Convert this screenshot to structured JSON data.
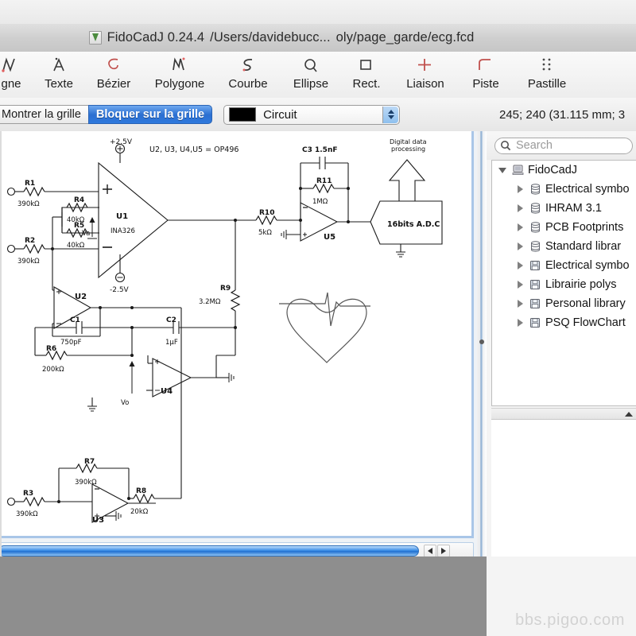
{
  "window": {
    "title_app": "FidoCadJ 0.24.4",
    "title_path": "/Users/davidebucc...",
    "title_file": "oly/page_garde/ecg.fcd",
    "app_icon": "fidocadj-leaf-icon"
  },
  "toolbar": {
    "tools": [
      {
        "label": "gne",
        "icon": "polyline-icon"
      },
      {
        "label": "Texte",
        "icon": "text-A-icon"
      },
      {
        "label": "Bézier",
        "icon": "bezier-curve-icon"
      },
      {
        "label": "Polygone",
        "icon": "polygon-icon"
      },
      {
        "label": "Courbe",
        "icon": "curve-icon"
      },
      {
        "label": "Ellipse",
        "icon": "ellipse-icon"
      },
      {
        "label": "Rect.",
        "icon": "rectangle-icon"
      },
      {
        "label": "Liaison",
        "icon": "connection-plus-icon"
      },
      {
        "label": "Piste",
        "icon": "track-icon"
      },
      {
        "label": "Pastille",
        "icon": "pad-dots-icon"
      }
    ]
  },
  "grid_toolbar": {
    "show_grid_label": "Montrer la grille",
    "snap_grid_label": "Bloquer sur la grille",
    "snap_active": true,
    "layer_color": "#000000",
    "layer_name": "Circuit"
  },
  "status": {
    "coordinates": "245; 240 (31.115 mm; 3"
  },
  "library_panel": {
    "search_placeholder": "Search",
    "search_value": "",
    "search_icon": "magnifier-icon",
    "tree": [
      {
        "label": "FidoCadJ",
        "icon": "computer-icon",
        "level": 1,
        "expanded": true
      },
      {
        "label": "Electrical symbo",
        "icon": "database-icon",
        "level": 2,
        "expanded": false
      },
      {
        "label": "IHRAM 3.1",
        "icon": "database-icon",
        "level": 2,
        "expanded": false
      },
      {
        "label": "PCB Footprints",
        "icon": "database-icon",
        "level": 2,
        "expanded": false
      },
      {
        "label": "Standard librar",
        "icon": "database-icon",
        "level": 2,
        "expanded": false
      },
      {
        "label": "Electrical symbo",
        "icon": "floppy-icon",
        "level": 2,
        "expanded": false
      },
      {
        "label": "Librairie polys",
        "icon": "floppy-icon",
        "level": 2,
        "expanded": false
      },
      {
        "label": "Personal library",
        "icon": "floppy-icon",
        "level": 2,
        "expanded": false
      },
      {
        "label": "PSQ FlowChart",
        "icon": "floppy-icon",
        "level": 2,
        "expanded": false
      }
    ]
  },
  "schematic": {
    "note_opamps": "U2, U3, U4,U5 = OP496",
    "labels": {
      "r1": "R1",
      "r1v": "390kΩ",
      "r2": "R2",
      "r2v": "390kΩ",
      "r3": "R3",
      "r3v": "390kΩ",
      "r4": "R4",
      "r4v": "40kΩ",
      "r5": "R5",
      "r5v": "40kΩ",
      "r6": "R6",
      "r6v": "200kΩ",
      "r7": "R7",
      "r7v": "390kΩ",
      "r8": "R8",
      "r8v": "20kΩ",
      "r9": "R9",
      "r9v": "3.2MΩ",
      "r10": "R10",
      "r10v": "5kΩ",
      "r11": "R11",
      "r11v": "1MΩ",
      "c1": "C1",
      "c1v": "750pF",
      "c2": "C2",
      "c2v": "1µF",
      "c3": "C3  1.5nF",
      "u1": "U1",
      "u1p": "INA326",
      "u2": "U2",
      "u3": "U3",
      "u4": "U4",
      "u5": "U5",
      "vplus": "+2.5V",
      "vminus": "-2.5V",
      "va": "Va",
      "vo": "Vo",
      "adc": "16bits A.D.C",
      "digital1": "Digital data",
      "digital2": "processing"
    }
  },
  "scrollbars": {
    "h_left_arrow": "scroll-left-icon",
    "h_right_arrow": "scroll-right-icon"
  },
  "watermark": "bbs.pigoo.com"
}
